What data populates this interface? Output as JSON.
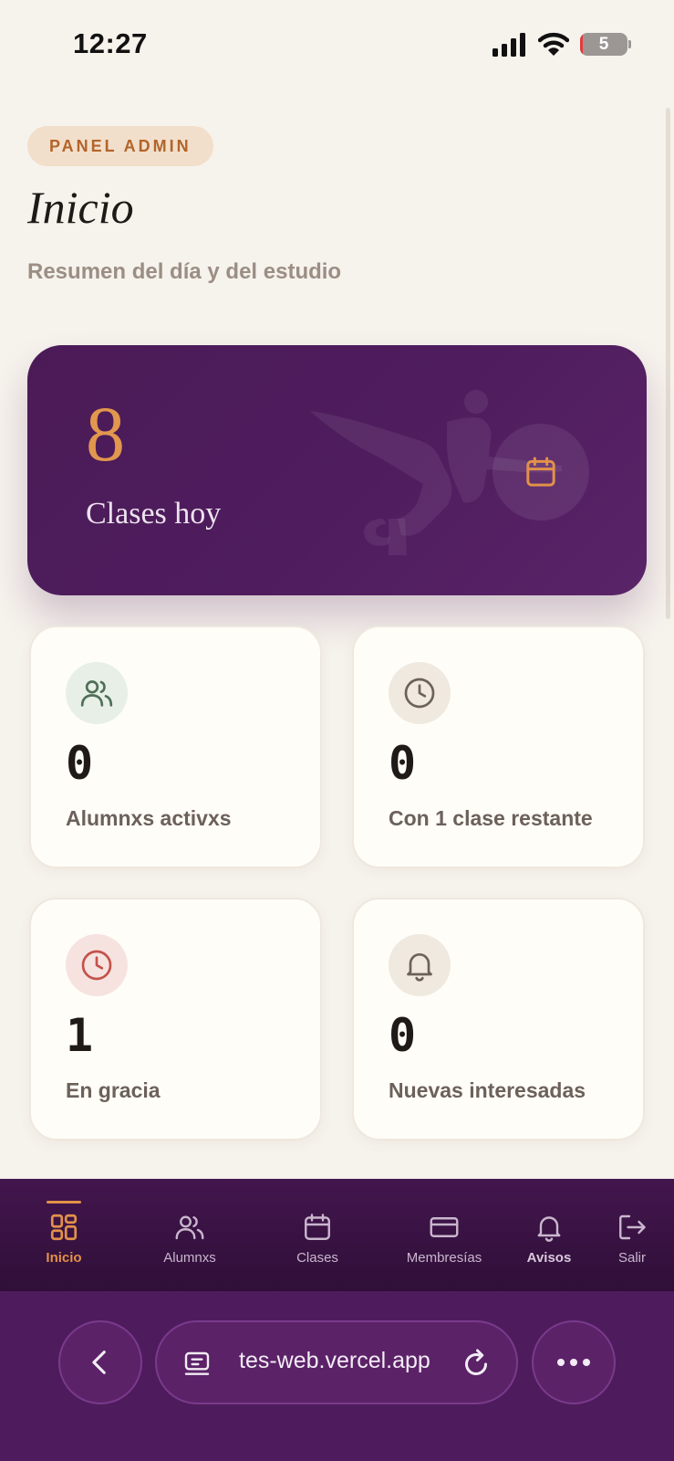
{
  "status_bar": {
    "time": "12:27",
    "battery_level": "5"
  },
  "header": {
    "badge": "PANEL ADMIN",
    "title": "Inicio",
    "subtitle": "Resumen del día y del estudio"
  },
  "hero": {
    "value": "8",
    "label": "Clases hoy",
    "icon": "calendar-icon"
  },
  "stats": [
    {
      "value": "0",
      "label": "Alumnxs activxs",
      "icon": "users-icon",
      "icon_bg": "#e7efe6",
      "icon_color": "#4f6f57"
    },
    {
      "value": "0",
      "label": "Con 1 clase restante",
      "icon": "clock-icon",
      "icon_bg": "#efe9df",
      "icon_color": "#6b625a"
    },
    {
      "value": "1",
      "label": "En gracia",
      "icon": "clock-icon",
      "icon_bg": "#f6e3e0",
      "icon_color": "#c4524a"
    },
    {
      "value": "0",
      "label": "Nuevas interesadas",
      "icon": "bell-icon",
      "icon_bg": "#efe9df",
      "icon_color": "#6b625a"
    }
  ],
  "nav": {
    "items": [
      {
        "label": "Inicio",
        "icon": "grid-icon",
        "active": true
      },
      {
        "label": "Alumnxs",
        "icon": "users-icon"
      },
      {
        "label": "Clases",
        "icon": "calendar-icon"
      },
      {
        "label": "Membresías",
        "icon": "card-icon"
      },
      {
        "label": "Avisos",
        "icon": "bell-icon"
      },
      {
        "label": "Salir",
        "icon": "logout-icon"
      }
    ]
  },
  "browser": {
    "url": "tes-web.vercel.app"
  },
  "colors": {
    "accent": "#e2914a",
    "primary": "#4b1b57"
  }
}
